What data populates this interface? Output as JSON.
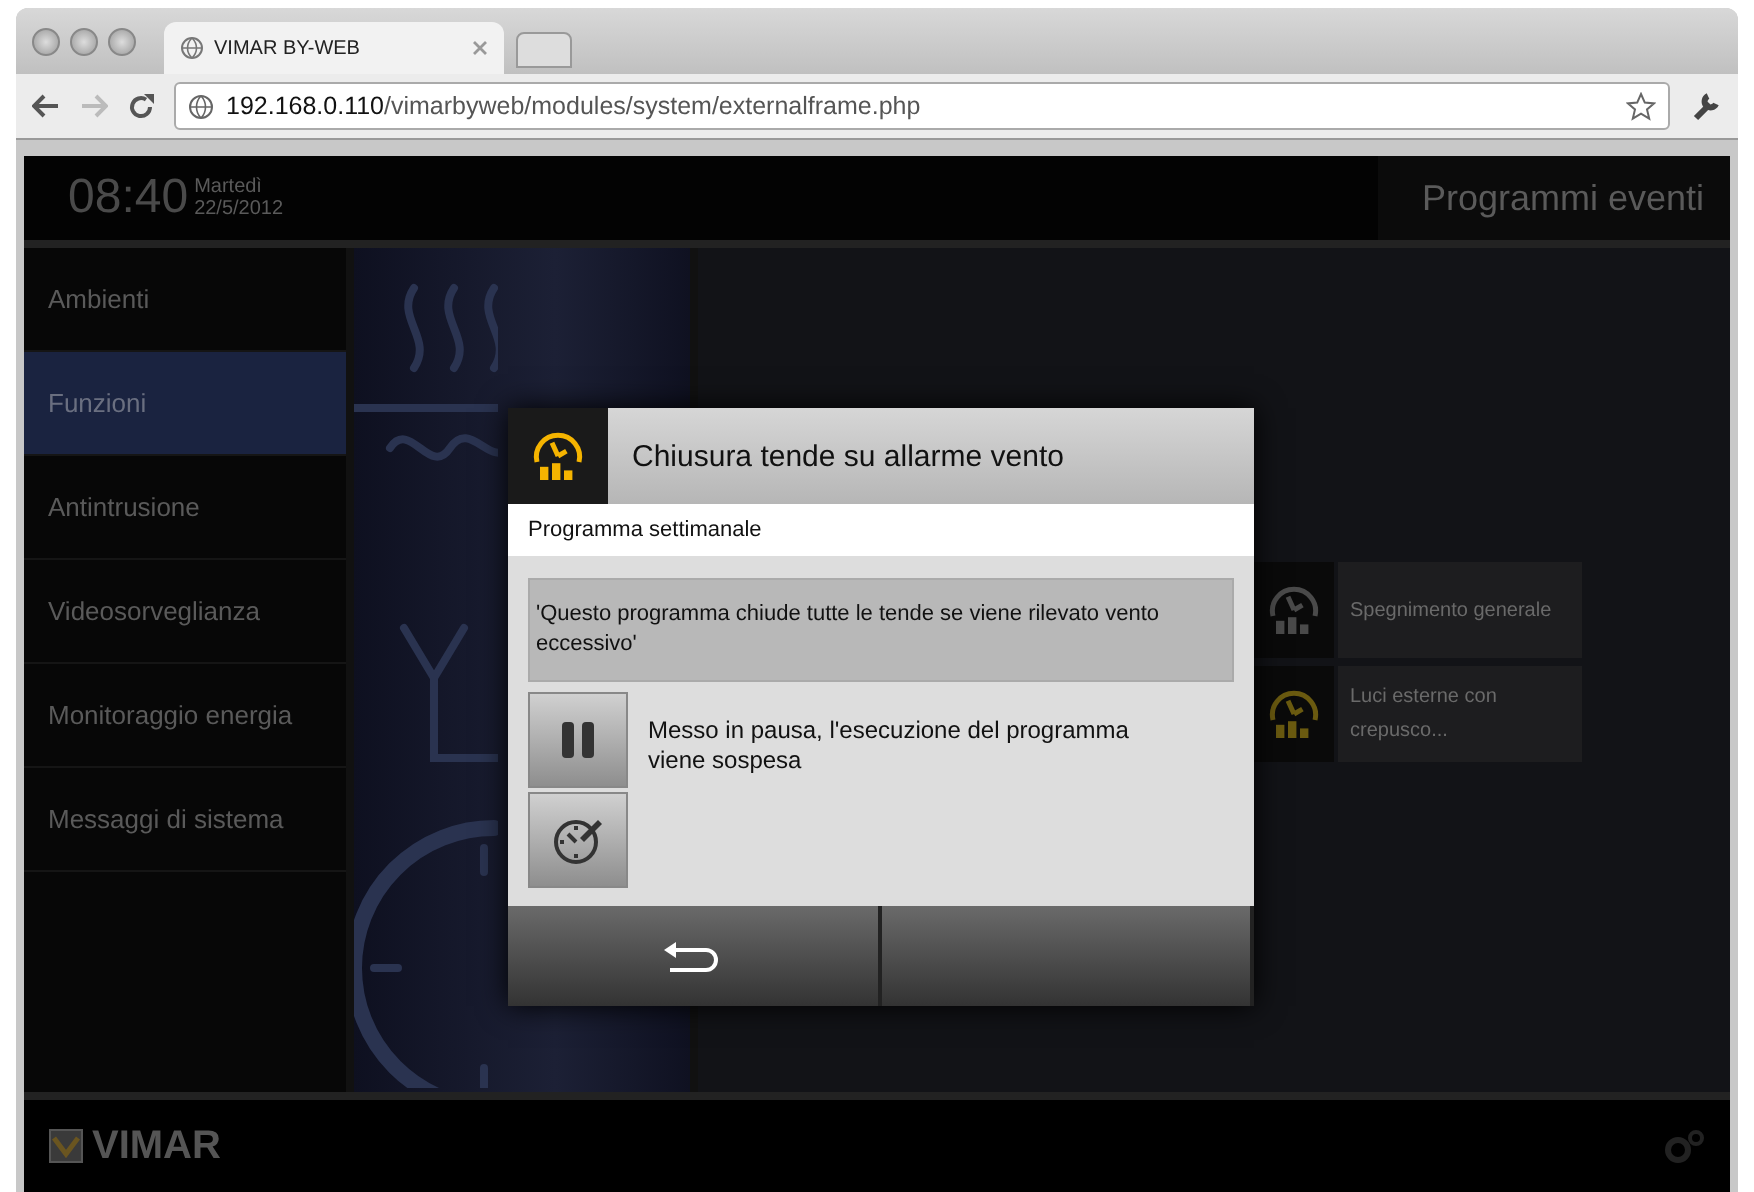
{
  "browser": {
    "tab_title": "VIMAR BY-WEB",
    "url_host": "192.168.0.110",
    "url_path": "/vimarbyweb/modules/system/externalframe.php"
  },
  "header": {
    "time": "08:40",
    "day": "Martedì",
    "date": "22/5/2012",
    "title": "Programmi eventi"
  },
  "sidebar": {
    "items": [
      {
        "label": "Ambienti",
        "selected": false
      },
      {
        "label": "Funzioni",
        "selected": true
      },
      {
        "label": "Antintrusione",
        "selected": false
      },
      {
        "label": "Videosorveglianza",
        "selected": false
      },
      {
        "label": "Monitoraggio energia",
        "selected": false
      },
      {
        "label": "Messaggi di sistema",
        "selected": false
      }
    ]
  },
  "programs": [
    {
      "label": "Spegnimento generale",
      "active": false
    },
    {
      "label": "Luci esterne con crepusco...",
      "active": true
    }
  ],
  "footer": {
    "brand": "VIMAR"
  },
  "dialog": {
    "title": "Chiusura tende su allarme vento",
    "active": true,
    "subtitle": "Programma settimanale",
    "description": "'Questo programma chiude tutte le tende se viene rilevato vento eccessivo'",
    "status": "Messo in pausa, l'esecuzione del programma viene sospesa"
  }
}
